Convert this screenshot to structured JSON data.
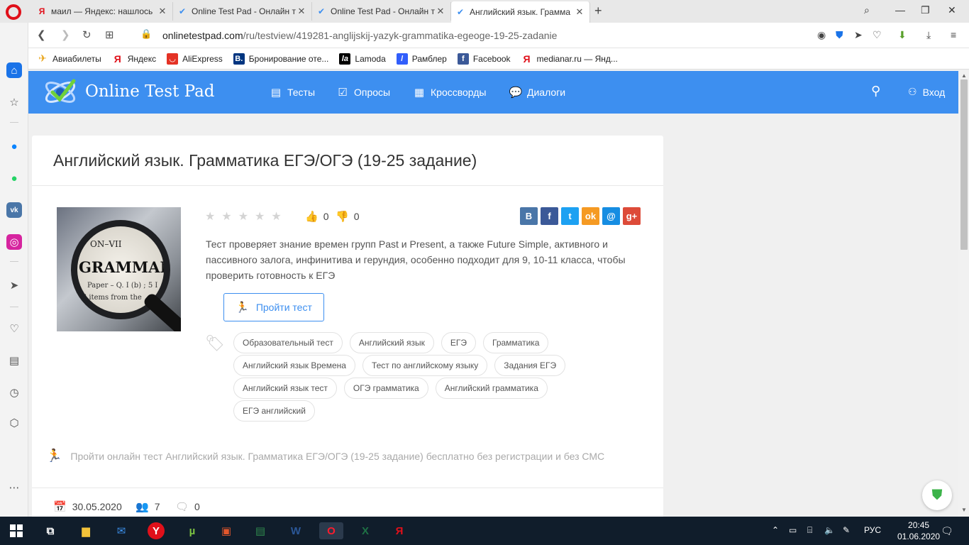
{
  "browser": {
    "tabs": [
      {
        "title": "маил — Яндекс: нашлось",
        "favicon": "yandex-icon"
      },
      {
        "title": "Online Test Pad - Онлайн т",
        "favicon": "otp-icon"
      },
      {
        "title": "Online Test Pad - Онлайн т",
        "favicon": "otp-icon"
      },
      {
        "title": "Английский язык. Граммa",
        "favicon": "otp-icon"
      }
    ],
    "url_domain": "onlinetestpad.com",
    "url_path": "/ru/testview/419281-anglijskij-yazyk-grammatika-egeoge-19-25-zadanie",
    "bookmarks": [
      "Авиабилеты",
      "Яндекс",
      "AliExpress",
      "Бронирование оте...",
      "Lamoda",
      "Рамблер",
      "Facebook",
      "medianar.ru — Янд..."
    ]
  },
  "site": {
    "logo_text": "Online Test Pad",
    "nav": [
      "Тесты",
      "Опросы",
      "Кроссворды",
      "Диалоги"
    ],
    "login": "Вход"
  },
  "test": {
    "title": "Английский язык. Грамматика ЕГЭ/ОГЭ (19-25 задание)",
    "image_text": {
      "top": "ON–VII",
      "main": "GRAMMAR",
      "line1": "Paper – Q. I (b) ; 5 I",
      "line2": "l items from the"
    },
    "rating_stars": 5,
    "likes": "0",
    "dislikes": "0",
    "description": "Тест проверяет знание времен групп Past и Present, а также Future Simple, активного и пассивного залога, инфинитива и герундия, особенно подходит для 9, 10-11 класса, чтобы проверить готовность к ЕГЭ",
    "take_button": "Пройти тест",
    "tags": [
      "Образовательный тест",
      "Английский язык",
      "ЕГЭ",
      "Грамматика",
      "Английский язык Времена",
      "Тест по английскому языку",
      "Задания ЕГЭ",
      "Английский язык тест",
      "ОГЭ грамматика",
      "Английский грамматика",
      "ЕГЭ английский"
    ],
    "cta": "Пройти онлайн тест Английский язык. Грамматика ЕГЭ/ОГЭ (19-25 задание) бесплатно без регистрации и без СМС",
    "date": "30.05.2020",
    "participants": "7",
    "comments": "0"
  },
  "social": [
    {
      "name": "vk",
      "label": "В",
      "color": "#4a76a8"
    },
    {
      "name": "facebook",
      "label": "f",
      "color": "#3b5998"
    },
    {
      "name": "twitter",
      "label": "t",
      "color": "#1da1f2"
    },
    {
      "name": "odnoklassniki",
      "label": "ok",
      "color": "#f59a23"
    },
    {
      "name": "mailru",
      "label": "@",
      "color": "#168de2"
    },
    {
      "name": "googleplus",
      "label": "g+",
      "color": "#dd4b39"
    }
  ],
  "taskbar": {
    "lang": "РУС",
    "time": "20:45",
    "date": "01.06.2020"
  },
  "colors": {
    "brand": "#3d8ff0",
    "taskbar": "#101d2b"
  }
}
